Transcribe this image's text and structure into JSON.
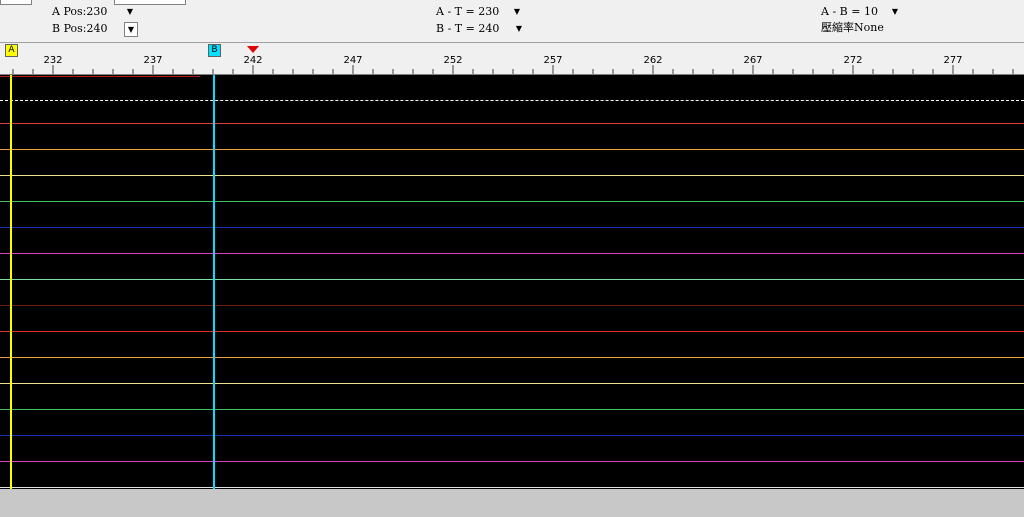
{
  "info": {
    "a_pos": "A Pos:230",
    "b_pos": "B Pos:240",
    "a_t": "A - T = 230",
    "b_t": "B - T = 240",
    "a_b": "A - B = 10",
    "compression": "壓縮率None",
    "dropdown_glyph": "▼"
  },
  "ruler": {
    "ticks": [
      "232",
      "237",
      "242",
      "247",
      "252",
      "257",
      "262",
      "267",
      "272",
      "277"
    ],
    "marker_a": "A",
    "marker_b": "B"
  },
  "colors": {
    "marker_a": "#ffff00",
    "marker_b": "#00e0ff",
    "cursor": "#e00000",
    "lines": [
      "#b01818",
      "#e04040",
      "#f0a040",
      "#f0e090",
      "#40c060",
      "#2030c0",
      "#e040c0",
      "#80e0a0",
      "#701c10",
      "#e03030",
      "#f0a040",
      "#f0e090",
      "#40c060",
      "#2030c0",
      "#e040c0",
      "#e0e0e0"
    ]
  }
}
